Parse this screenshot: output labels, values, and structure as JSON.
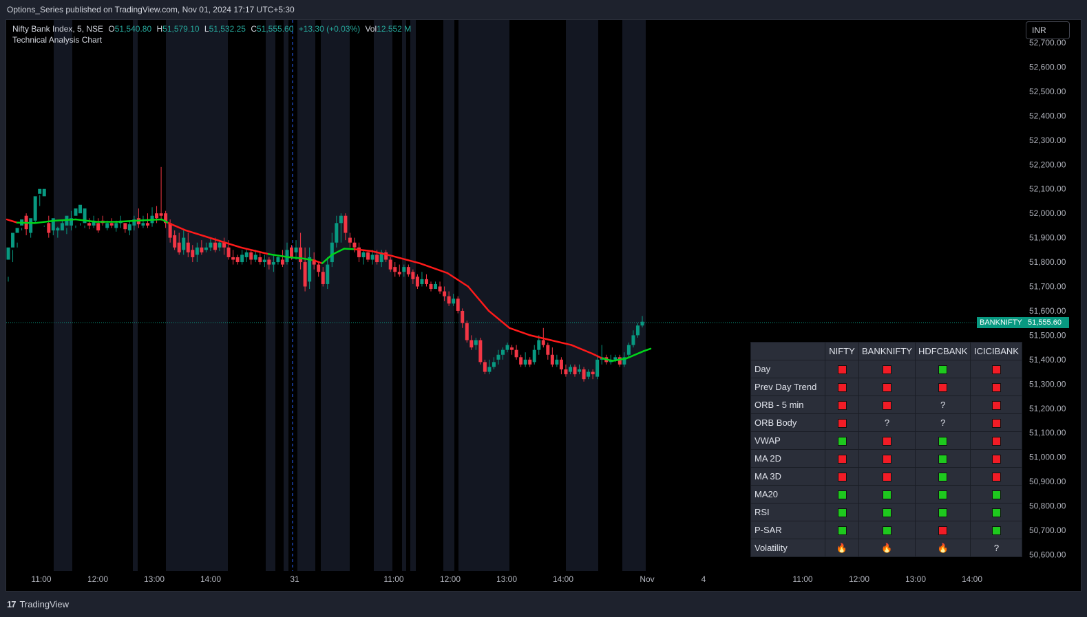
{
  "header": {
    "publish_line": "Options_Series published on TradingView.com, Nov 01, 2024 17:17 UTC+5:30"
  },
  "footer": {
    "brand": "TradingView"
  },
  "legend": {
    "symbol": "Nifty Bank Index, 5, NSE",
    "o_label": "O",
    "o_value": "51,540.80",
    "h_label": "H",
    "h_value": "51,579.10",
    "l_label": "L",
    "l_value": "51,532.25",
    "c_label": "C",
    "c_value": "51,555.60",
    "change": "+13.30 (+0.03%)",
    "vol_label": "Vol",
    "vol_value": "12.552 M",
    "subtitle": "Technical Analysis Chart"
  },
  "currency_button": "INR",
  "price_tag": {
    "symbol": "BANKNIFTY",
    "value": "51,555.60"
  },
  "colors": {
    "up": "#089981",
    "down": "#f23645",
    "ema_bull": "#00d41a",
    "ema_bear": "#ff1a1a",
    "session_shade": "#131722",
    "background": "#000000"
  },
  "chart_data": {
    "type": "candlestick",
    "title": "Nifty Bank Index, 5, NSE",
    "subtitle": "Technical Analysis Chart",
    "y_axis": {
      "ticks": [
        "52,700.00",
        "52,600.00",
        "52,500.00",
        "52,400.00",
        "52,300.00",
        "52,200.00",
        "52,100.00",
        "52,000.00",
        "51,900.00",
        "51,800.00",
        "51,700.00",
        "51,600.00",
        "51,500.00",
        "51,400.00",
        "51,300.00",
        "51,200.00",
        "51,100.00",
        "51,000.00",
        "50,900.00",
        "50,800.00",
        "50,700.00",
        "50,600.00"
      ],
      "range": [
        50555,
        52715
      ]
    },
    "x_axis": {
      "ticks": [
        "11:00",
        "12:00",
        "13:00",
        "14:00",
        "31",
        "11:00",
        "12:00",
        "13:00",
        "14:00",
        "Nov",
        "4",
        "11:00",
        "12:00",
        "13:00",
        "14:00"
      ]
    },
    "last_price": 51555.6,
    "ema_series": [
      [
        0,
        51975
      ],
      [
        15,
        51962
      ],
      [
        40,
        51960
      ],
      [
        70,
        51970
      ],
      [
        100,
        51975
      ],
      [
        130,
        51965
      ],
      [
        160,
        51965
      ],
      [
        200,
        51972
      ],
      [
        225,
        51975
      ],
      [
        235,
        51960
      ],
      [
        260,
        51930
      ],
      [
        300,
        51895
      ],
      [
        340,
        51860
      ],
      [
        380,
        51833
      ],
      [
        410,
        51820
      ],
      [
        430,
        51815
      ],
      [
        445,
        51808
      ],
      [
        458,
        51795
      ],
      [
        472,
        51830
      ],
      [
        490,
        51855
      ],
      [
        505,
        51853
      ],
      [
        530,
        51845
      ],
      [
        560,
        51825
      ],
      [
        600,
        51795
      ],
      [
        640,
        51755
      ],
      [
        670,
        51700
      ],
      [
        700,
        51600
      ],
      [
        730,
        51530
      ],
      [
        760,
        51500
      ],
      [
        790,
        51480
      ],
      [
        820,
        51460
      ],
      [
        850,
        51425
      ],
      [
        865,
        51405
      ],
      [
        880,
        51395
      ],
      [
        900,
        51405
      ],
      [
        925,
        51435
      ],
      [
        935,
        51445
      ]
    ],
    "ema_bull_ranges": [
      [
        15,
        235
      ],
      [
        395,
        440
      ],
      [
        458,
        505
      ],
      [
        780,
        800
      ],
      [
        865,
        935
      ]
    ],
    "candles": [
      [
        51810,
        51860,
        51740,
        51720
      ],
      [
        51860,
        51920,
        51850,
        51800
      ],
      [
        51920,
        51940,
        51860,
        51880
      ],
      [
        51950,
        51975,
        51940,
        51930
      ],
      [
        51990,
        51935,
        52000,
        51910
      ],
      [
        51920,
        51980,
        51950,
        51900
      ],
      [
        51970,
        52070,
        51970,
        51960
      ],
      [
        52080,
        52100,
        52075,
        52030
      ],
      [
        52070,
        52100,
        51950,
        51945
      ],
      [
        51960,
        51920,
        51990,
        51900
      ],
      [
        51930,
        51980,
        51960,
        51910
      ],
      [
        51930,
        51940,
        51945,
        51900
      ],
      [
        51930,
        51960,
        51970,
        51930
      ],
      [
        51950,
        51990,
        51940,
        51915
      ],
      [
        51950,
        51980,
        52010,
        51930
      ],
      [
        51990,
        52020,
        51950,
        51940
      ],
      [
        52000,
        52035,
        51960,
        51950
      ],
      [
        51960,
        52020,
        51950,
        51940
      ],
      [
        51960,
        51950,
        51980,
        51935
      ],
      [
        51950,
        51970,
        51990,
        51940
      ],
      [
        51960,
        51930,
        51980,
        51920
      ],
      [
        51970,
        51960,
        51990,
        51950
      ],
      [
        51940,
        51960,
        51970,
        51930
      ],
      [
        51960,
        51950,
        51980,
        51940
      ],
      [
        51940,
        51960,
        51970,
        51925
      ],
      [
        51960,
        51970,
        51990,
        51940
      ],
      [
        51960,
        51935,
        51960,
        51920
      ],
      [
        51930,
        51955,
        51970,
        51910
      ],
      [
        51950,
        51975,
        51990,
        51930
      ],
      [
        51980,
        51955,
        52020,
        51940
      ],
      [
        51950,
        51960,
        51990,
        51940
      ],
      [
        51960,
        51950,
        52000,
        51940
      ],
      [
        51960,
        51990,
        52025,
        51945
      ],
      [
        52000,
        51980,
        52030,
        51960
      ],
      [
        52000,
        51990,
        52190,
        51970
      ],
      [
        52000,
        51960,
        52010,
        51940
      ],
      [
        51960,
        51900,
        51975,
        51880
      ],
      [
        51910,
        51860,
        51930,
        51850
      ],
      [
        51880,
        51840,
        51920,
        51830
      ],
      [
        51850,
        51900,
        51930,
        51830
      ],
      [
        51880,
        51840,
        51920,
        51820
      ],
      [
        51850,
        51820,
        51870,
        51800
      ],
      [
        51830,
        51860,
        51880,
        51800
      ],
      [
        51860,
        51840,
        51890,
        51830
      ],
      [
        51850,
        51860,
        51880,
        51840
      ],
      [
        51860,
        51880,
        51900,
        51845
      ],
      [
        51880,
        51850,
        51900,
        51840
      ],
      [
        51860,
        51880,
        51890,
        51845
      ],
      [
        51880,
        51860,
        51900,
        51830
      ],
      [
        51860,
        51820,
        51890,
        51810
      ],
      [
        51820,
        51810,
        51850,
        51790
      ],
      [
        51820,
        51800,
        51830,
        51790
      ],
      [
        51800,
        51830,
        51850,
        51790
      ],
      [
        51820,
        51840,
        51850,
        51800
      ],
      [
        51840,
        51810,
        51850,
        51790
      ],
      [
        51810,
        51830,
        51850,
        51800
      ],
      [
        51820,
        51800,
        51840,
        51790
      ],
      [
        51800,
        51810,
        51830,
        51780
      ],
      [
        51810,
        51790,
        51820,
        51770
      ],
      [
        51790,
        51800,
        51830,
        51760
      ],
      [
        51800,
        51820,
        51830,
        51790
      ],
      [
        51810,
        51790,
        51850,
        51780
      ],
      [
        51800,
        51850,
        51880,
        51790
      ],
      [
        51860,
        51820,
        51870,
        51810
      ],
      [
        51840,
        51860,
        51890,
        51810
      ],
      [
        51860,
        51800,
        51920,
        51770
      ],
      [
        51800,
        51700,
        51860,
        51680
      ],
      [
        51720,
        51820,
        51860,
        51690
      ],
      [
        51810,
        51790,
        51840,
        51770
      ],
      [
        51790,
        51760,
        51800,
        51740
      ],
      [
        51760,
        51710,
        51780,
        51700
      ],
      [
        51710,
        51790,
        51820,
        51690
      ],
      [
        51800,
        51880,
        51920,
        51780
      ],
      [
        51880,
        51960,
        51990,
        51860
      ],
      [
        51960,
        51990,
        52000,
        51880
      ],
      [
        51990,
        51920,
        52000,
        51890
      ],
      [
        51900,
        51880,
        51920,
        51860
      ],
      [
        51880,
        51860,
        51900,
        51840
      ],
      [
        51860,
        51820,
        51880,
        51800
      ],
      [
        51820,
        51840,
        51850,
        51790
      ],
      [
        51840,
        51810,
        51850,
        51800
      ],
      [
        51810,
        51830,
        51850,
        51790
      ],
      [
        51830,
        51800,
        51850,
        51790
      ],
      [
        51800,
        51840,
        51850,
        51780
      ],
      [
        51840,
        51810,
        51850,
        51800
      ],
      [
        51810,
        51770,
        51820,
        51760
      ],
      [
        51780,
        51760,
        51800,
        51740
      ],
      [
        51760,
        51750,
        51790,
        51740
      ],
      [
        51760,
        51780,
        51790,
        51740
      ],
      [
        51780,
        51750,
        51790,
        51740
      ],
      [
        51760,
        51730,
        51770,
        51710
      ],
      [
        51740,
        51700,
        51750,
        51690
      ],
      [
        51710,
        51730,
        51760,
        51700
      ],
      [
        51730,
        51710,
        51750,
        51700
      ],
      [
        51710,
        51690,
        51720,
        51680
      ],
      [
        51690,
        51710,
        51720,
        51690
      ],
      [
        51700,
        51680,
        51720,
        51670
      ],
      [
        51680,
        51660,
        51700,
        51640
      ],
      [
        51660,
        51630,
        51680,
        51620
      ],
      [
        51630,
        51650,
        51670,
        51620
      ],
      [
        51650,
        51600,
        51660,
        51590
      ],
      [
        51600,
        51550,
        51610,
        51530
      ],
      [
        51550,
        51480,
        51560,
        51470
      ],
      [
        51480,
        51450,
        51500,
        51440
      ],
      [
        51460,
        51480,
        51490,
        51440
      ],
      [
        51480,
        51390,
        51490,
        51380
      ],
      [
        51390,
        51350,
        51400,
        51340
      ],
      [
        51350,
        51370,
        51400,
        51340
      ],
      [
        51370,
        51390,
        51410,
        51360
      ],
      [
        51400,
        51420,
        51440,
        51380
      ],
      [
        51420,
        51440,
        51450,
        51400
      ],
      [
        51440,
        51460,
        51470,
        51430
      ],
      [
        51450,
        51440,
        51460,
        51420
      ],
      [
        51440,
        51410,
        51460,
        51400
      ],
      [
        51410,
        51380,
        51420,
        51370
      ],
      [
        51380,
        51400,
        51430,
        51370
      ],
      [
        51400,
        51380,
        51410,
        51370
      ],
      [
        51390,
        51440,
        51460,
        51380
      ],
      [
        51440,
        51480,
        51500,
        51420
      ],
      [
        51480,
        51460,
        51530,
        51450
      ],
      [
        51460,
        51420,
        51470,
        51400
      ],
      [
        51420,
        51380,
        51450,
        51370
      ],
      [
        51380,
        51400,
        51420,
        51370
      ],
      [
        51400,
        51360,
        51410,
        51340
      ],
      [
        51360,
        51340,
        51380,
        51330
      ],
      [
        51350,
        51370,
        51380,
        51340
      ],
      [
        51370,
        51340,
        51380,
        51330
      ],
      [
        51350,
        51360,
        51380,
        51340
      ],
      [
        51360,
        51320,
        51370,
        51310
      ],
      [
        51330,
        51350,
        51360,
        51320
      ],
      [
        51350,
        51340,
        51360,
        51320
      ],
      [
        51330,
        51400,
        51420,
        51320
      ],
      [
        51400,
        51410,
        51460,
        51380
      ],
      [
        51410,
        51390,
        51420,
        51380
      ],
      [
        51390,
        51400,
        51420,
        51380
      ],
      [
        51400,
        51410,
        51420,
        51390
      ],
      [
        51410,
        51380,
        51420,
        51370
      ],
      [
        51380,
        51410,
        51430,
        51370
      ],
      [
        51420,
        51460,
        51470,
        51410
      ],
      [
        51460,
        51500,
        51520,
        51450
      ],
      [
        51500,
        51540,
        51550,
        51490
      ],
      [
        51540,
        51555.6,
        51579.1,
        51532.25
      ]
    ]
  },
  "signal_table": {
    "columns": [
      "NIFTY",
      "BANKNIFTY",
      "HDFCBANK",
      "ICICIBANK"
    ],
    "rows": [
      {
        "label": "Day",
        "cells": [
          "red",
          "red",
          "green",
          "red"
        ]
      },
      {
        "label": "Prev Day Trend",
        "cells": [
          "red",
          "red",
          "red",
          "red"
        ]
      },
      {
        "label": "ORB - 5 min",
        "cells": [
          "red",
          "red",
          "?",
          "red"
        ]
      },
      {
        "label": "ORB Body",
        "cells": [
          "red",
          "?",
          "?",
          "red"
        ]
      },
      {
        "label": "VWAP",
        "cells": [
          "green",
          "red",
          "green",
          "red"
        ]
      },
      {
        "label": "MA 2D",
        "cells": [
          "red",
          "red",
          "green",
          "red"
        ]
      },
      {
        "label": "MA 3D",
        "cells": [
          "red",
          "red",
          "green",
          "red"
        ]
      },
      {
        "label": "MA20",
        "cells": [
          "green",
          "green",
          "green",
          "green"
        ]
      },
      {
        "label": "RSI",
        "cells": [
          "green",
          "green",
          "green",
          "green"
        ]
      },
      {
        "label": "P-SAR",
        "cells": [
          "green",
          "green",
          "red",
          "green"
        ]
      },
      {
        "label": "Volatility",
        "cells": [
          "🔥",
          "🔥",
          "🔥",
          "?"
        ]
      }
    ]
  }
}
